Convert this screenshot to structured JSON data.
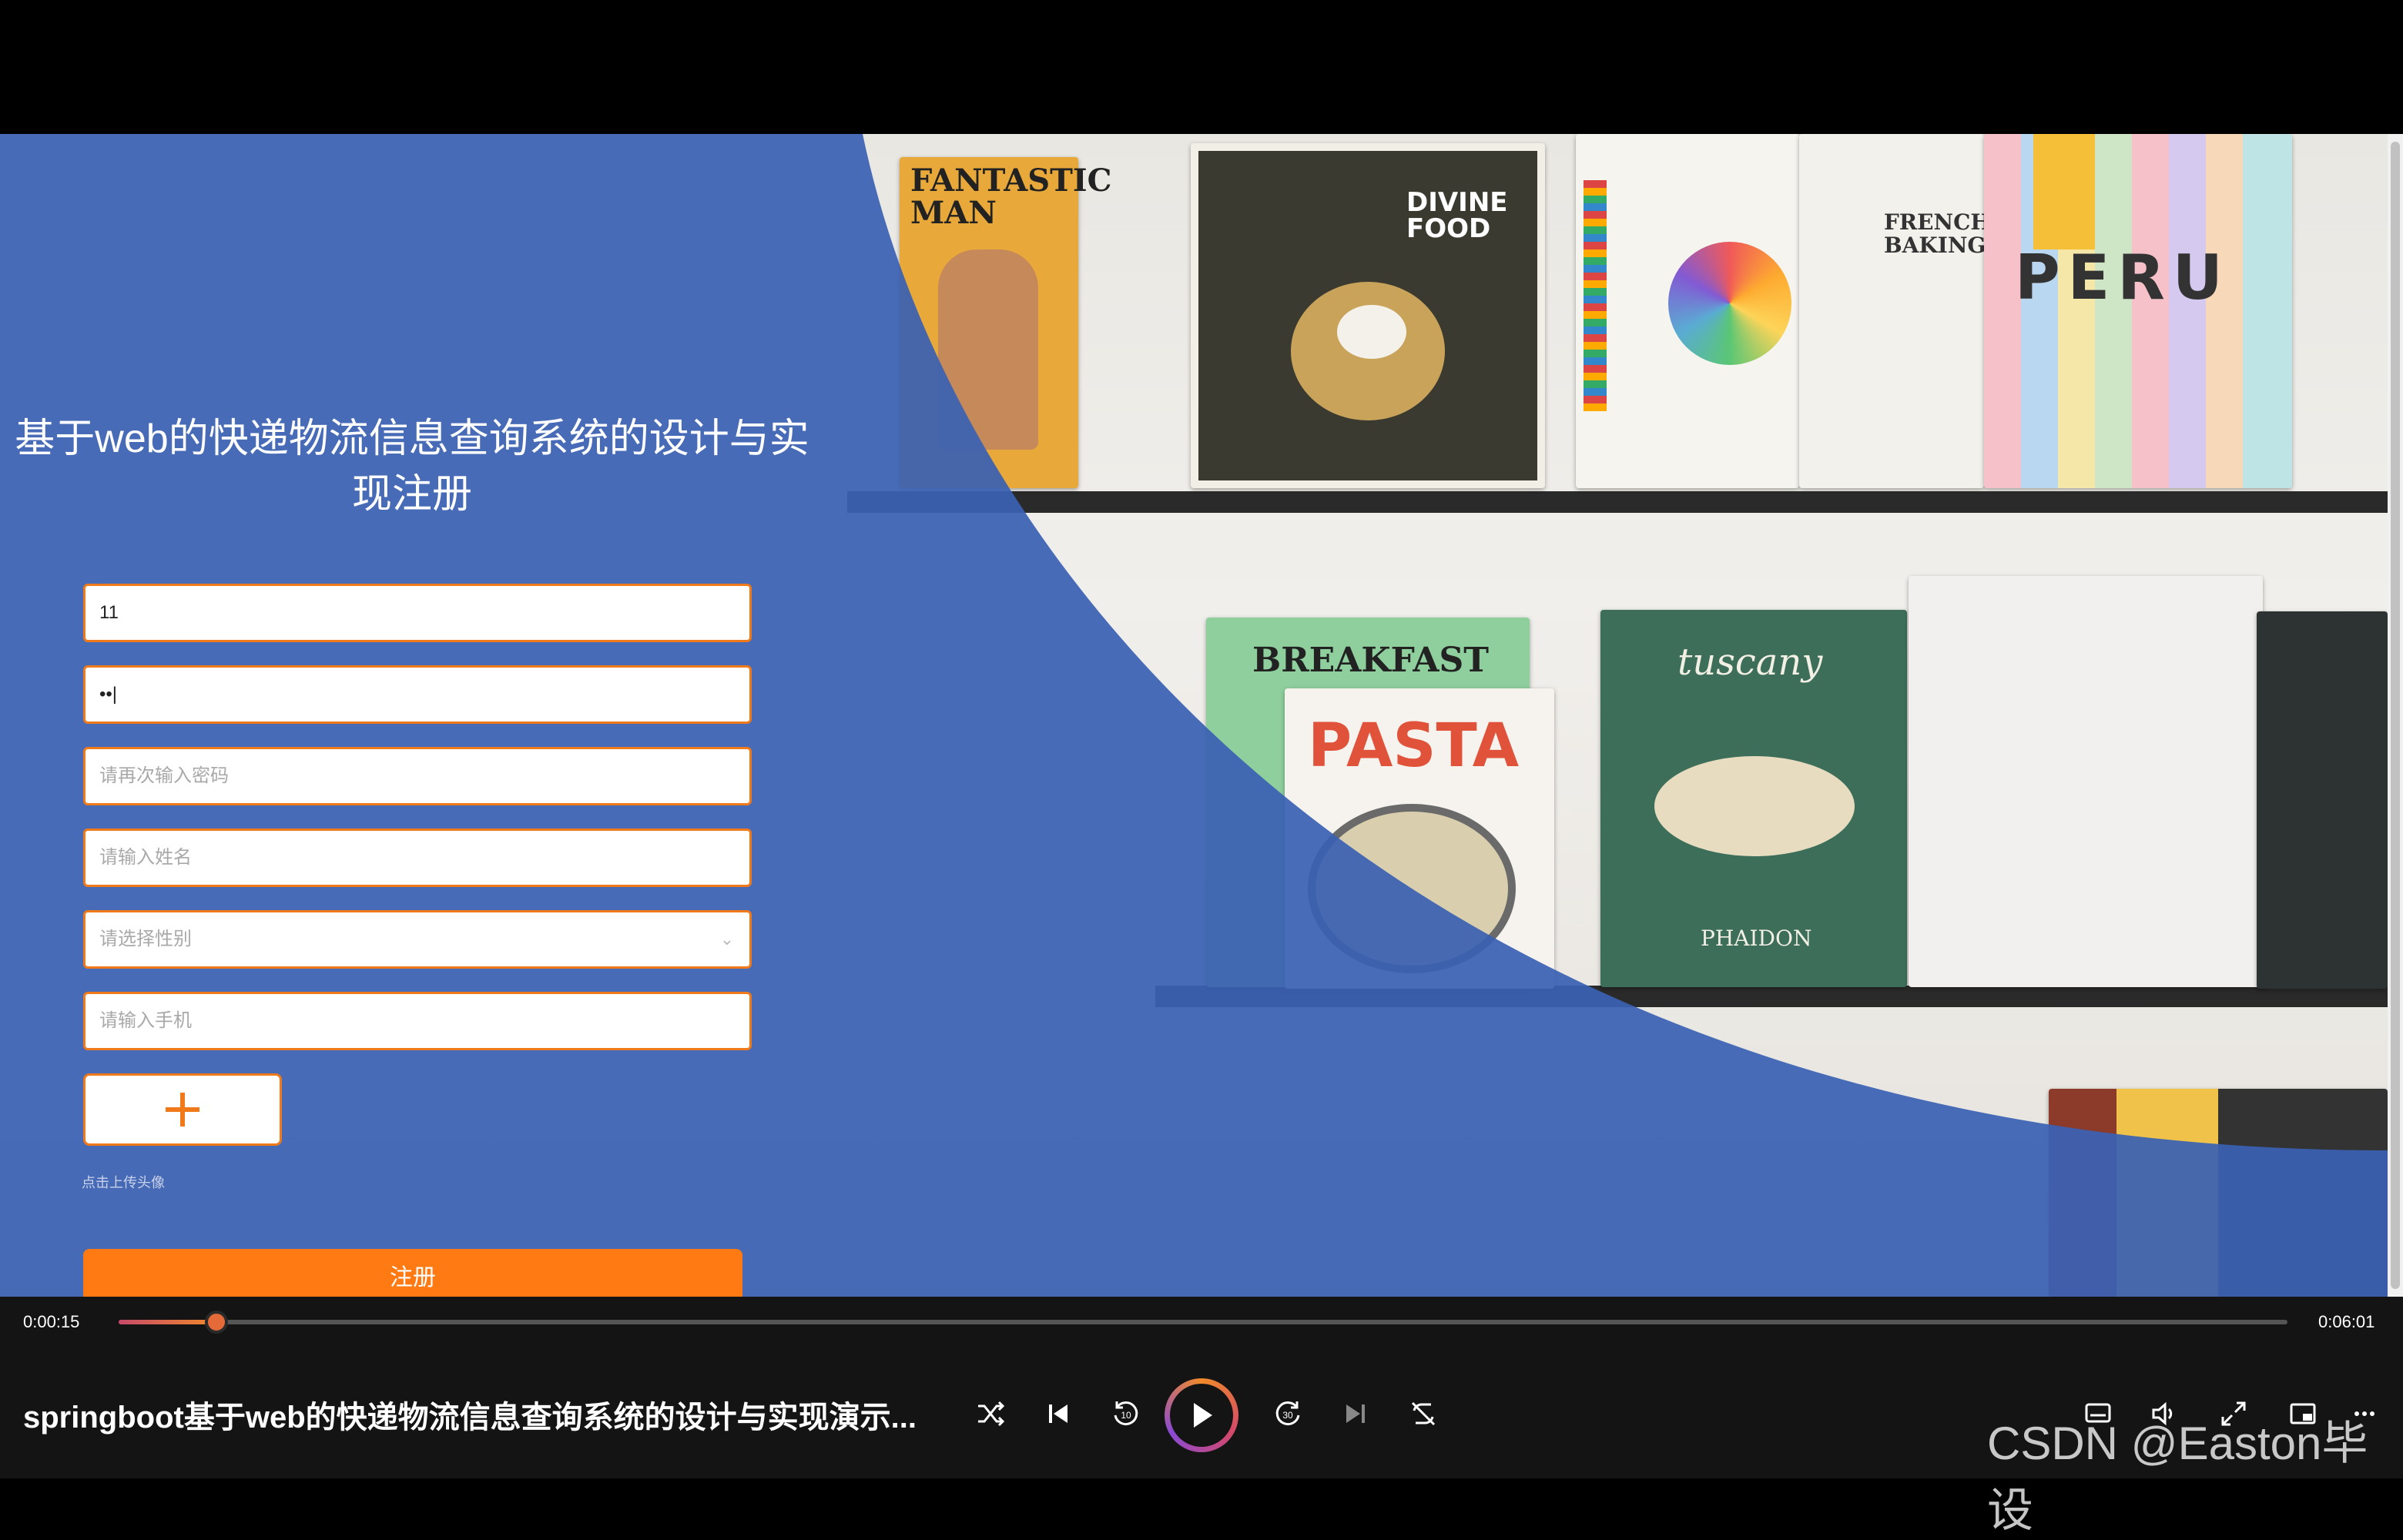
{
  "form": {
    "title": "基于web的快递物流信息查询系统的设计与实现注册",
    "fields": [
      {
        "value": "11",
        "placeholder": ""
      },
      {
        "value": "••|",
        "placeholder": ""
      },
      {
        "value": "",
        "placeholder": "请再次输入密码"
      },
      {
        "value": "",
        "placeholder": "请输入姓名"
      },
      {
        "value": "",
        "placeholder": "请选择性别"
      },
      {
        "value": "",
        "placeholder": "请输入手机"
      }
    ],
    "upload_icon": "plus-icon",
    "upload_hint": "点击上传头像",
    "submit_label": "注册"
  },
  "player": {
    "current_time": "0:00:15",
    "total_time": "0:06:01",
    "progress": 0.045,
    "title": "springboot基于web的快递物流信息查询系统的设计与实现演示...",
    "skip_back_label": "10",
    "skip_forward_label": "30"
  },
  "books": {
    "fantastic_man": "FANTASTIC MAN",
    "divine_food": "DIVINE FOOD",
    "french_baking": "FRENCH BAKING",
    "peru": "PERU",
    "breakfast": "BREAKFAST",
    "pasta": "PASTA",
    "tuscany": "tuscany",
    "phaidon": "PHAIDON"
  },
  "watermark": "CSDN @Easton毕设",
  "colors": {
    "accent": "#ff7a13",
    "overlay_blue": "#3a61b3",
    "field_border": "#f07a1a"
  }
}
